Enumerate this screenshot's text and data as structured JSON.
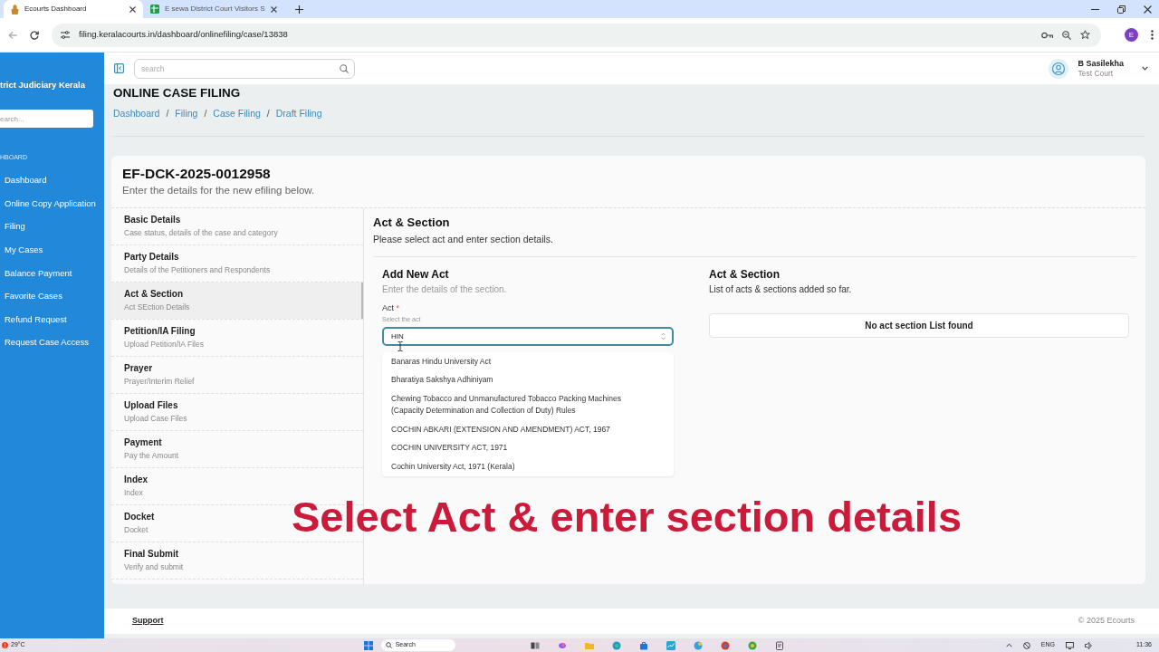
{
  "browser": {
    "tabs": [
      {
        "title": "Ecourts Dashboard",
        "selected": true
      },
      {
        "title": "E sewa District Court Visitors S",
        "selected": false
      }
    ],
    "url": "filing.keralacourts.in/dashboard/onlinefiling/case/13838",
    "profile_initial": "E"
  },
  "sidebar": {
    "title": "trict Judiciary Kerala",
    "search_placeholder": "earch...",
    "section": "HBOARD",
    "items": [
      "Dashboard",
      "Online Copy Application",
      "Filing",
      "My Cases",
      "Balance Payment",
      "Favorite Cases",
      "Refund Request",
      "Request Case Access"
    ]
  },
  "header": {
    "search_placeholder": "search",
    "user_name": "B Sasilekha",
    "user_court": "Test Court"
  },
  "page": {
    "title": "ONLINE CASE FILING",
    "breadcrumb": [
      "Dashboard",
      "Filing",
      "Case Filing",
      "Draft Filing"
    ],
    "breadcrumb_separator": "/"
  },
  "filing": {
    "number": "EF-DCK-2025-0012958",
    "subtitle": "Enter the details for the new efiling below.",
    "steps": [
      {
        "title": "Basic Details",
        "subtitle": "Case status, details of the case and category",
        "selected": false
      },
      {
        "title": "Party Details",
        "subtitle": "Details of the Petitioners and Respondents",
        "selected": false
      },
      {
        "title": "Act & Section",
        "subtitle": "Act SEction Details",
        "selected": true
      },
      {
        "title": "Petition/IA Filing",
        "subtitle": "Upload Petition/IA Files",
        "selected": false
      },
      {
        "title": "Prayer",
        "subtitle": "Prayer/Interim Relief",
        "selected": false
      },
      {
        "title": "Upload Files",
        "subtitle": "Upload Case Files",
        "selected": false
      },
      {
        "title": "Payment",
        "subtitle": "Pay the Amount",
        "selected": false
      },
      {
        "title": "Index",
        "subtitle": "Index",
        "selected": false
      },
      {
        "title": "Docket",
        "subtitle": "Docket",
        "selected": false
      },
      {
        "title": "Final Submit",
        "subtitle": "Verify and submit",
        "selected": false
      }
    ]
  },
  "act_section": {
    "title": "Act & Section",
    "subtitle": "Please select act and enter section details.",
    "add_form": {
      "title": "Add New Act",
      "subtitle": "Enter the details of the section.",
      "field": {
        "label": "Act",
        "required_mark": "*",
        "hint": "Select the act",
        "value": "HIN",
        "options": [
          "Banaras Hindu University Act",
          "Bharatiya Sakshya Adhiniyam",
          "Chewing Tobacco and Unmanufactured Tobacco Packing Machines (Capacity Determination and Collection of Duty) Rules",
          "COCHIN ABKARI (EXTENSION AND AMENDMENT) ACT, 1967",
          "COCHIN UNIVERSITY ACT, 1971",
          "Cochin University Act, 1971 (Kerala)"
        ]
      }
    },
    "list": {
      "title": "Act & Section",
      "subtitle": "List of acts & sections added so far.",
      "empty_message": "No act section List found"
    }
  },
  "caption": "Select Act & enter section details",
  "footer": {
    "support": "Support",
    "copyright": "© 2025 Ecourts"
  },
  "taskbar": {
    "temperature": "29°C",
    "search": "Search",
    "language": "ENG",
    "time": "11:36"
  }
}
